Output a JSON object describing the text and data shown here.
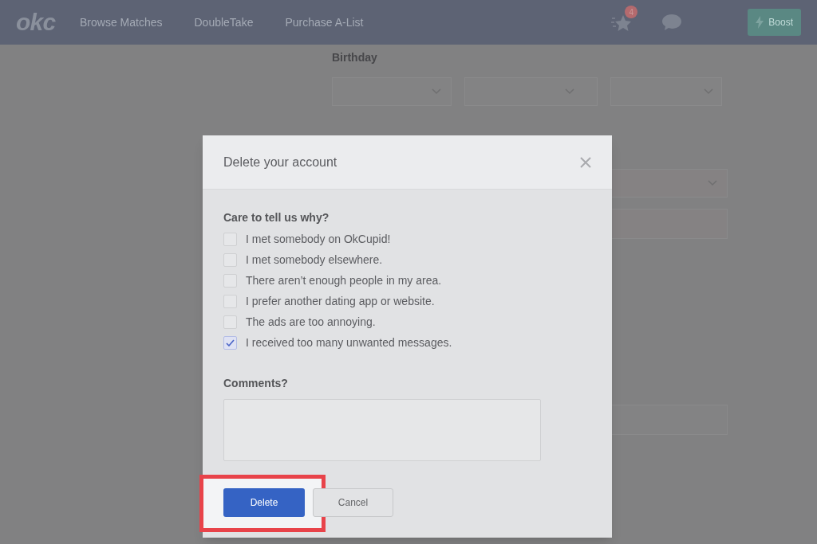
{
  "nav": {
    "logo": "okc",
    "links": [
      {
        "label": "Browse Matches"
      },
      {
        "label": "DoubleTake"
      },
      {
        "label": "Purchase A-List"
      }
    ],
    "notification_count": "4",
    "boost_button": "Boost"
  },
  "background_form": {
    "birthday_label": "Birthday"
  },
  "dialog": {
    "title": "Delete your account",
    "question": "Care to tell us why?",
    "reasons": [
      {
        "label": "I met somebody on OkCupid!",
        "checked": false
      },
      {
        "label": "I met somebody elsewhere.",
        "checked": false
      },
      {
        "label": "There aren’t enough people in my area.",
        "checked": false
      },
      {
        "label": "I prefer another dating app or website.",
        "checked": false
      },
      {
        "label": "The ads are too annoying.",
        "checked": false
      },
      {
        "label": "I received too many unwanted messages.",
        "checked": true
      }
    ],
    "comments_label": "Comments?",
    "delete_button": "Delete",
    "cancel_button": "Cancel"
  }
}
